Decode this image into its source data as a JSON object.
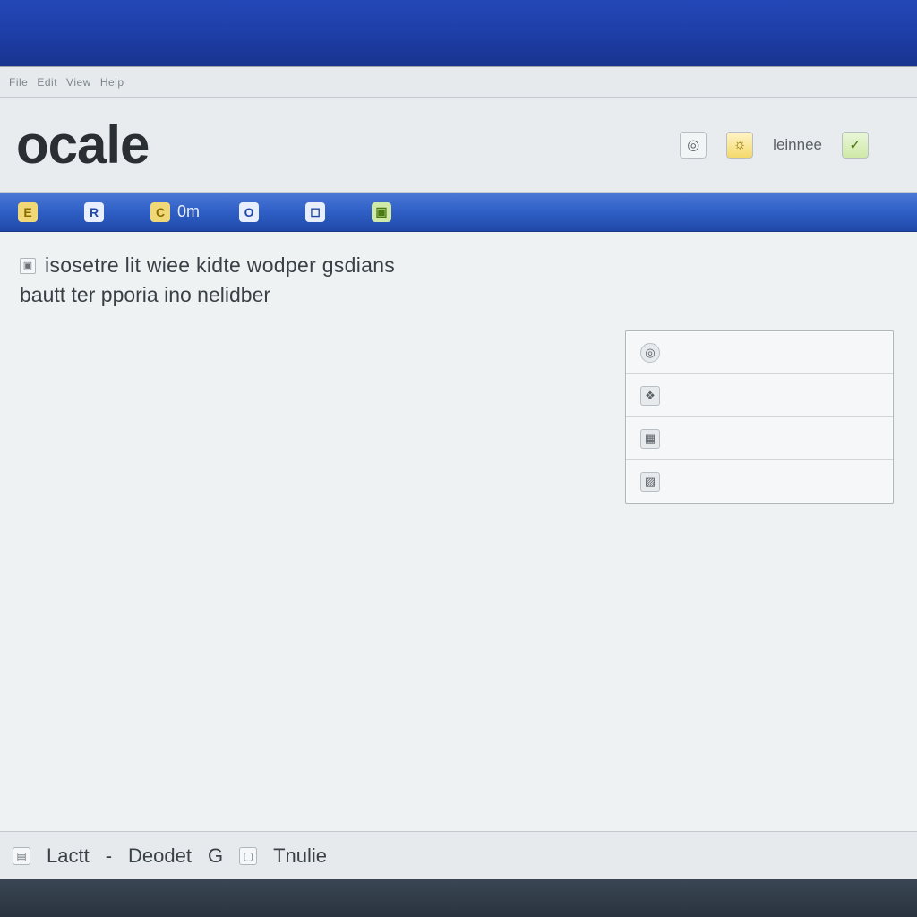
{
  "menustrip": {
    "items": [
      "File",
      "Edit",
      "View",
      "Help"
    ]
  },
  "header": {
    "logo_text": "ocale",
    "right": {
      "icon1": "◎",
      "icon2": "☼",
      "label": "leinnee",
      "icon3": "✓"
    }
  },
  "toolbar": {
    "items": [
      {
        "icon": "E",
        "label": ""
      },
      {
        "icon": "R",
        "label": ""
      },
      {
        "icon": "C",
        "label": "0m"
      },
      {
        "icon": "O",
        "label": ""
      },
      {
        "icon": "◻",
        "label": ""
      },
      {
        "icon": "▣",
        "label": ""
      }
    ]
  },
  "content": {
    "line1": "isosetre lit wiee kidte wodper gsdians",
    "line2": "bautt ter pporia ino nelidber"
  },
  "panel": {
    "rows": [
      {
        "icon": "◎",
        "label": ""
      },
      {
        "icon": "❖",
        "label": ""
      },
      {
        "icon": "▦",
        "label": ""
      },
      {
        "icon": "▨",
        "label": ""
      }
    ]
  },
  "statusbar": {
    "seg1": "Lactt",
    "seg2": "Deodet",
    "seg3": "G",
    "seg4": "Tnulie"
  }
}
